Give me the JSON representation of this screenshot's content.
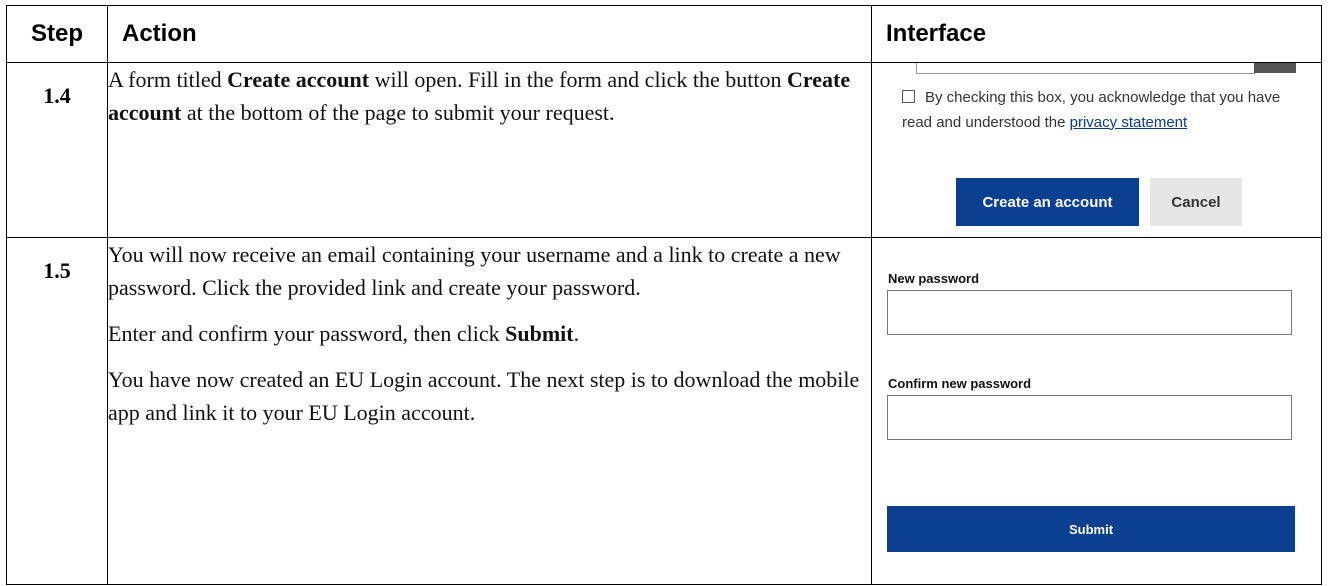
{
  "table": {
    "headers": {
      "step": "Step",
      "action": "Action",
      "interface": "Interface"
    }
  },
  "rows": [
    {
      "step": "1.4",
      "action": {
        "p1_part1": "A form titled ",
        "p1_bold1": "Create account",
        "p1_part2": " will open. Fill in the form and click the button ",
        "p1_bold2": "Create account",
        "p1_part3": " at the bottom of the page to submit your request."
      },
      "interface": {
        "checkbox_text": "By checking this box, you acknowledge that you have read and understood the ",
        "privacy_link": "privacy statement",
        "create_button": "Create an account",
        "cancel_button": "Cancel"
      }
    },
    {
      "step": "1.5",
      "action": {
        "p1": "You will now receive an email containing your username and a link to create a new password. Click the provided link and create your password.",
        "p2_part1": "Enter and confirm your password, then click ",
        "p2_bold": "Submit",
        "p2_part2": ".",
        "p3": "You have now created an EU Login account. The next step is to download the mobile app and link it to your EU Login account."
      },
      "interface": {
        "new_password_label": "New password",
        "confirm_password_label": "Confirm new password",
        "submit_button": "Submit"
      }
    }
  ],
  "colors": {
    "eu_blue": "#0b3f8f",
    "cancel_grey": "#e6e6e6"
  }
}
